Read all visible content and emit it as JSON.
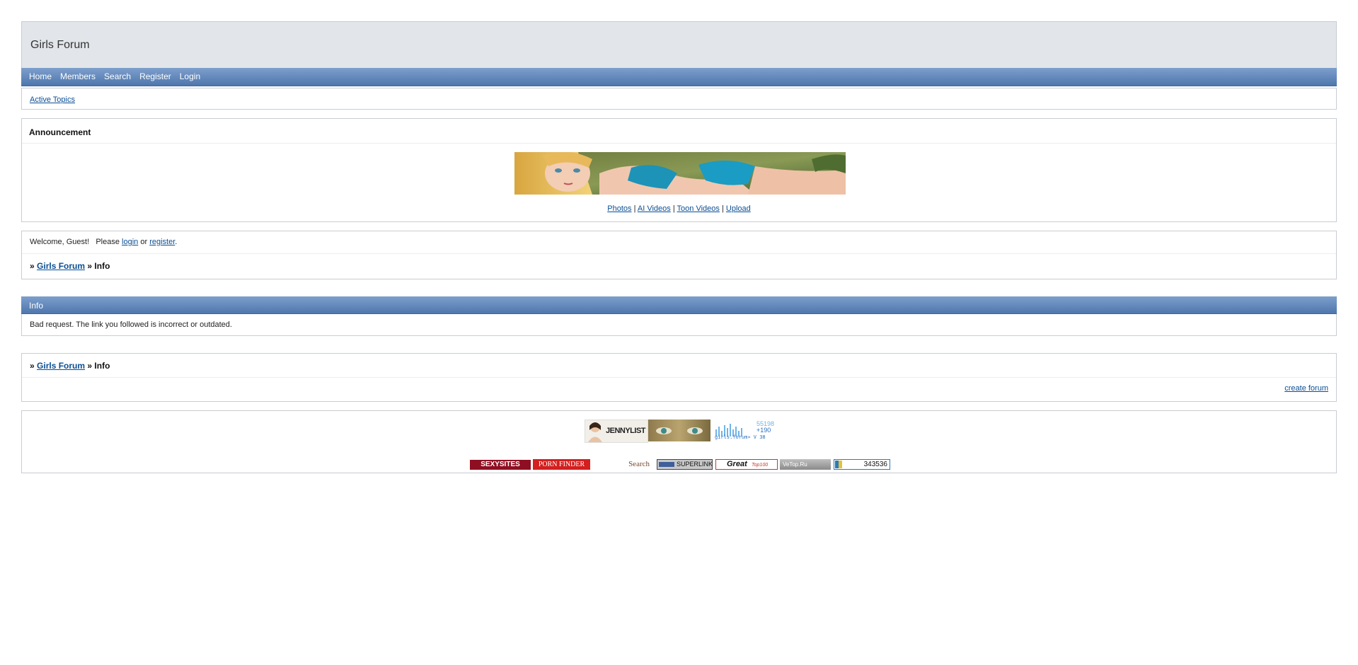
{
  "site": {
    "title": "Girls Forum"
  },
  "nav": {
    "home": "Home",
    "members": "Members",
    "search": "Search",
    "register": "Register",
    "login": "Login"
  },
  "quick": {
    "active_topics": "Active Topics"
  },
  "announcement": {
    "title": "Announcement",
    "links": {
      "photos": "Photos",
      "ai_videos": "AI Videos",
      "toon_videos": "Toon Videos",
      "upload": "Upload"
    },
    "separator": "|"
  },
  "welcome": {
    "prefix": "Welcome, Guest!",
    "please": "Please",
    "login": "login",
    "or": "or",
    "register": "register",
    "suffix": "."
  },
  "breadcrumb": {
    "marker": "»",
    "forum": "Girls Forum",
    "current": "Info"
  },
  "info": {
    "header": "Info",
    "message": "Bad request. The link you followed is incorrect or outdated."
  },
  "footer": {
    "create_forum": "create forum",
    "badges": {
      "jennylist": "JENNYLIST",
      "counter_top": "55198",
      "counter_mid": "+190",
      "counter_bottom": "girls.forum» V 38",
      "sexysites": "SEXYSITES",
      "porn_finder": "PORN FINDER",
      "search": "Search",
      "superlink": "SUPERLINK",
      "great": "Great",
      "great_sub": "Top100",
      "vetop": "VeTop.Ru",
      "hits": "343536"
    }
  },
  "colors": {
    "nav_top": "#7d9fcc",
    "nav_bottom": "#4f77ad",
    "header_bg": "#e2e6ea",
    "link": "#0b4e94"
  }
}
